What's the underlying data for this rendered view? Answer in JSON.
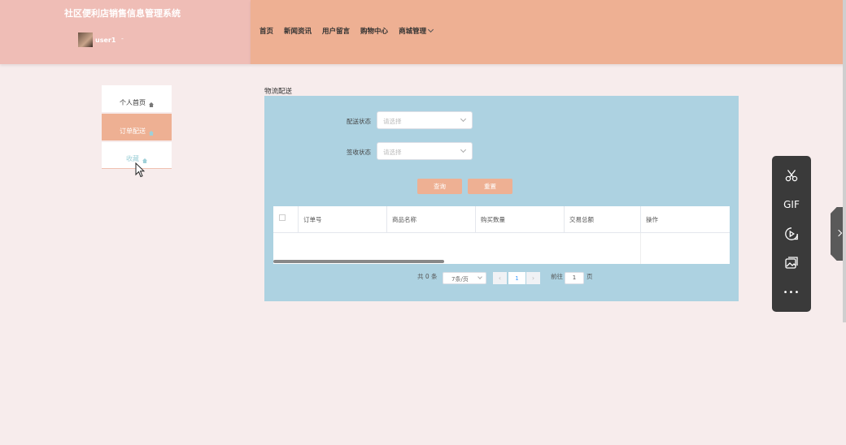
{
  "header": {
    "site_title": "社区便利店销售信息管理系统",
    "username": "user1",
    "user_caret": "-",
    "nav": [
      {
        "label": "首页"
      },
      {
        "label": "新闻资讯"
      },
      {
        "label": "用户留言"
      },
      {
        "label": "购物中心"
      },
      {
        "label": "商城管理"
      }
    ]
  },
  "sidebar": {
    "items": [
      {
        "label": "个人首页"
      },
      {
        "label": "订单配送"
      },
      {
        "label": "收藏"
      }
    ]
  },
  "main": {
    "section_title": "物流配送",
    "filters": [
      {
        "label": "配送状态",
        "placeholder": "请选择"
      },
      {
        "label": "签收状态",
        "placeholder": "请选择"
      }
    ],
    "buttons": {
      "query": "查询",
      "reset": "重置"
    },
    "table": {
      "headers": [
        "订单号",
        "商品名称",
        "购买数量",
        "交易总额",
        "操作"
      ],
      "rows": []
    },
    "pagination": {
      "total": "共 0 条",
      "page_size": "7条/页",
      "prev": "‹",
      "current_page": "1",
      "next": "›",
      "goto_label": "前往",
      "goto_value": "1",
      "page_suffix": "页"
    }
  },
  "float_toolbar": {
    "gif_label": "GIF",
    "more_label": "•••"
  },
  "colors": {
    "header_left": "#efbdb6",
    "header_right": "#eeb093",
    "panel": "#add2e1",
    "accent": "#eeb093"
  }
}
